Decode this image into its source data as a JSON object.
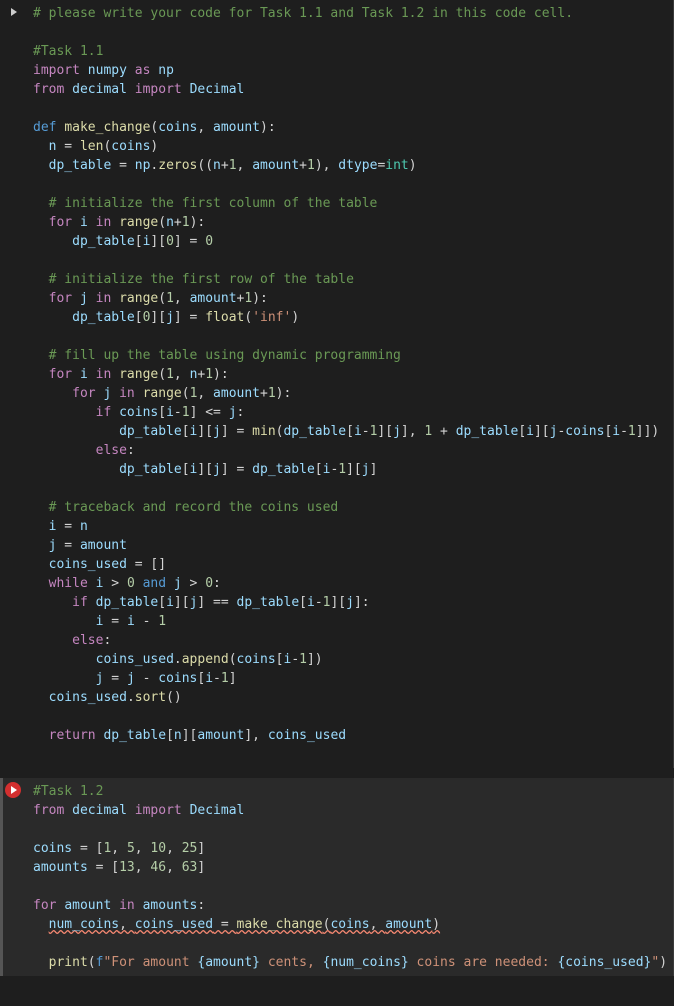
{
  "cell1": {
    "l1": "# please write your code for Task 1.1 and Task 1.2 in this code cell.",
    "l2": "#Task 1.1",
    "l3_import": "import",
    "l3_numpy": "numpy",
    "l3_as": "as",
    "l3_np": "np",
    "l4_from": "from",
    "l4_decimal": "decimal",
    "l4_import": "import",
    "l4_Decimal": "Decimal",
    "l5_def": "def",
    "l5_fn": "make_change",
    "l5_p1": "coins",
    "l5_p2": "amount",
    "l6_n": "n",
    "l6_len": "len",
    "l6_coins": "coins",
    "l7_dp": "dp_table",
    "l7_np": "np",
    "l7_zeros": "zeros",
    "l7_n1": "n",
    "l7_num1": "1",
    "l7_amt": "amount",
    "l7_num2": "1",
    "l7_dtype": "dtype",
    "l7_int": "int",
    "l8": "# initialize the first column of the table",
    "l9_for": "for",
    "l9_i": "i",
    "l9_in": "in",
    "l9_range": "range",
    "l9_n": "n",
    "l9_1": "1",
    "l10_dp": "dp_table",
    "l10_i": "i",
    "l10_0a": "0",
    "l10_0b": "0",
    "l11": "# initialize the first row of the table",
    "l12_for": "for",
    "l12_j": "j",
    "l12_in": "in",
    "l12_range": "range",
    "l12_1": "1",
    "l12_amt": "amount",
    "l12_1b": "1",
    "l13_dp": "dp_table",
    "l13_0": "0",
    "l13_j": "j",
    "l13_float": "float",
    "l13_inf": "'inf'",
    "l14": "# fill up the table using dynamic programming",
    "l15_for": "for",
    "l15_i": "i",
    "l15_in": "in",
    "l15_range": "range",
    "l15_1": "1",
    "l15_n": "n",
    "l15_1b": "1",
    "l16_for": "for",
    "l16_j": "j",
    "l16_in": "in",
    "l16_range": "range",
    "l16_1": "1",
    "l16_amt": "amount",
    "l16_1b": "1",
    "l17_if": "if",
    "l17_coins": "coins",
    "l17_i": "i",
    "l17_1": "1",
    "l17_j": "j",
    "l18_dp": "dp_table",
    "l18_i": "i",
    "l18_j": "j",
    "l18_min": "min",
    "l18_dp2": "dp_table",
    "l18_i2": "i",
    "l18_1": "1",
    "l18_j2": "j",
    "l18_1b": "1",
    "l18_dp3": "dp_table",
    "l18_i3": "i",
    "l18_j3": "j",
    "l18_coins": "coins",
    "l18_i4": "i",
    "l18_1c": "1",
    "l19_else": "else",
    "l20_dp": "dp_table",
    "l20_i": "i",
    "l20_j": "j",
    "l20_dp2": "dp_table",
    "l20_i2": "i",
    "l20_1": "1",
    "l20_j2": "j",
    "l21": "# traceback and record the coins used",
    "l22_i": "i",
    "l22_n": "n",
    "l23_j": "j",
    "l23_amt": "amount",
    "l24_cu": "coins_used",
    "l25_while": "while",
    "l25_i": "i",
    "l25_0": "0",
    "l25_and": "and",
    "l25_j": "j",
    "l25_0b": "0",
    "l26_if": "if",
    "l26_dp": "dp_table",
    "l26_i": "i",
    "l26_j": "j",
    "l26_dp2": "dp_table",
    "l26_i2": "i",
    "l26_1": "1",
    "l26_j2": "j",
    "l27_i": "i",
    "l27_i2": "i",
    "l27_1": "1",
    "l28_else": "else",
    "l29_cu": "coins_used",
    "l29_app": "append",
    "l29_coins": "coins",
    "l29_i": "i",
    "l29_1": "1",
    "l30_j": "j",
    "l30_j2": "j",
    "l30_coins": "coins",
    "l30_i": "i",
    "l30_1": "1",
    "l31_cu": "coins_used",
    "l31_sort": "sort",
    "l32_return": "return",
    "l32_dp": "dp_table",
    "l32_n": "n",
    "l32_amt": "amount",
    "l32_cu": "coins_used"
  },
  "cell2": {
    "l1": "#Task 1.2",
    "l2_from": "from",
    "l2_decimal": "decimal",
    "l2_import": "import",
    "l2_Decimal": "Decimal",
    "l3_coins": "coins",
    "l3_v1": "1",
    "l3_v5": "5",
    "l3_v10": "10",
    "l3_v25": "25",
    "l4_amts": "amounts",
    "l4_v13": "13",
    "l4_v46": "46",
    "l4_v63": "63",
    "l5_for": "for",
    "l5_amt": "amount",
    "l5_in": "in",
    "l5_amts": "amounts",
    "l6_nc": "num_coins",
    "l6_cu": "coins_used",
    "l6_mc": "make_change",
    "l6_coins": "coins",
    "l6_amt": "amount",
    "l7_print": "print",
    "l7_f": "f",
    "l7_s1": "\"For amount ",
    "l7_b1": "{amount}",
    "l7_s2": " cents, ",
    "l7_b2": "{num_coins}",
    "l7_s3": " coins are needed: ",
    "l7_b3": "{coins_used}",
    "l7_s4": "\""
  }
}
